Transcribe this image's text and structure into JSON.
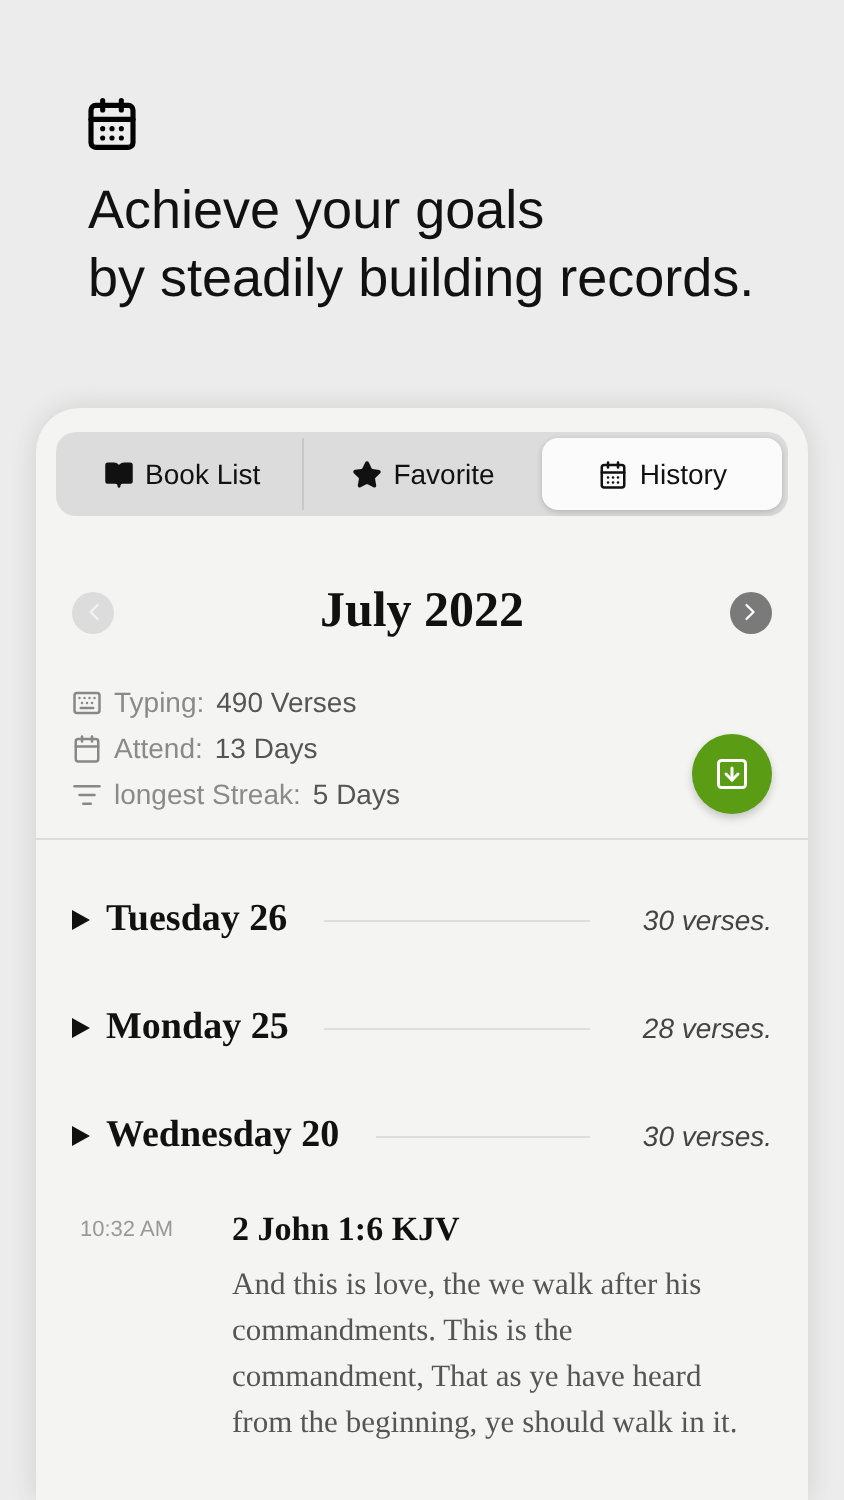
{
  "headline": {
    "lines": [
      "Achieve your goals",
      "by steadily building records."
    ]
  },
  "tabs": [
    {
      "label": "Book List",
      "selected": false
    },
    {
      "label": "Favorite",
      "selected": false
    },
    {
      "label": "History",
      "selected": true
    }
  ],
  "month": {
    "title": "July 2022",
    "prev": {
      "disabled": true
    },
    "next": {
      "disabled": false
    }
  },
  "stats": [
    {
      "label": "Typing:",
      "value": "490 Verses"
    },
    {
      "label": "Attend:",
      "value": "13 Days"
    },
    {
      "label": "longest Streak:",
      "value": "5 Days"
    }
  ],
  "days": [
    {
      "title": "Tuesday 26",
      "count": "30 verses."
    },
    {
      "title": "Monday 25",
      "count": "28 verses."
    },
    {
      "title": "Wednesday 20",
      "count": "30 verses.",
      "entries": [
        {
          "time": "10:32 AM",
          "reference": "2 John 1:6 KJV",
          "text": "And this is love, the we walk after his commandments. This is the commandment, That as ye have heard from the beginning, ye should walk in it."
        }
      ]
    }
  ]
}
